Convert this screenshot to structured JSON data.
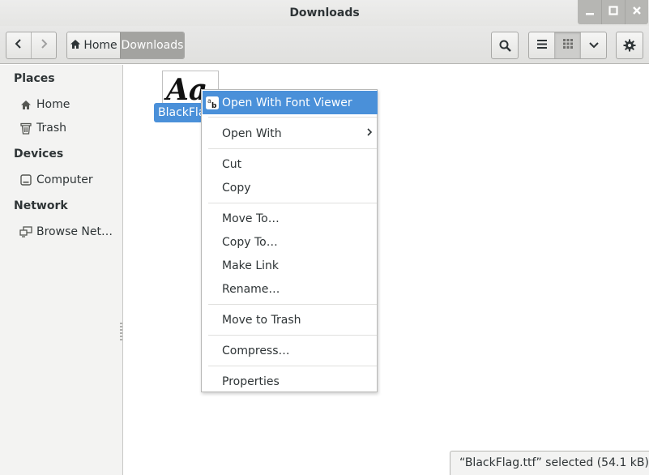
{
  "window": {
    "title": "Downloads",
    "controls": {
      "minimize": "–",
      "maximize": "□",
      "close": "×"
    }
  },
  "toolbar": {
    "back_icon": "chevron-left-icon",
    "forward_icon": "chevron-right-icon",
    "path": {
      "home_label": "Home",
      "current_label": "Downloads"
    },
    "search_icon": "search-icon",
    "view_list_icon": "list-view-icon",
    "view_grid_icon": "grid-view-icon",
    "view_menu_icon": "chevron-down-icon",
    "settings_icon": "gear-icon"
  },
  "sidebar": {
    "sections": [
      {
        "heading": "Places",
        "items": [
          {
            "label": "Home",
            "icon": "home-icon"
          },
          {
            "label": "Trash",
            "icon": "trash-icon"
          }
        ]
      },
      {
        "heading": "Devices",
        "items": [
          {
            "label": "Computer",
            "icon": "drive-icon"
          }
        ]
      },
      {
        "heading": "Network",
        "items": [
          {
            "label": "Browse Net…",
            "icon": "network-icon"
          }
        ]
      }
    ]
  },
  "files": [
    {
      "name": "BlackFlag.ttf",
      "visible_label": "BlackFla",
      "icon": "font-file-icon",
      "selected": true
    }
  ],
  "context_menu": {
    "items": [
      {
        "label": "Open With Font Viewer",
        "icon": "font-viewer-icon",
        "highlighted": true
      },
      {
        "label": "Open With",
        "submenu": true
      },
      {
        "label": "Cut"
      },
      {
        "label": "Copy"
      },
      {
        "label": "Move To…"
      },
      {
        "label": "Copy To…"
      },
      {
        "label": "Make Link"
      },
      {
        "label": "Rename…"
      },
      {
        "label": "Move to Trash"
      },
      {
        "label": "Compress…"
      },
      {
        "label": "Properties"
      }
    ]
  },
  "status": {
    "text": "“BlackFlag.ttf” selected  (54.1 kB)"
  },
  "colors": {
    "selection": "#4a90d9",
    "sidebar_bg": "#f3f3f2",
    "headerbar_bg": "#e8e8e7",
    "path_active_bg": "#a3a3a0"
  }
}
